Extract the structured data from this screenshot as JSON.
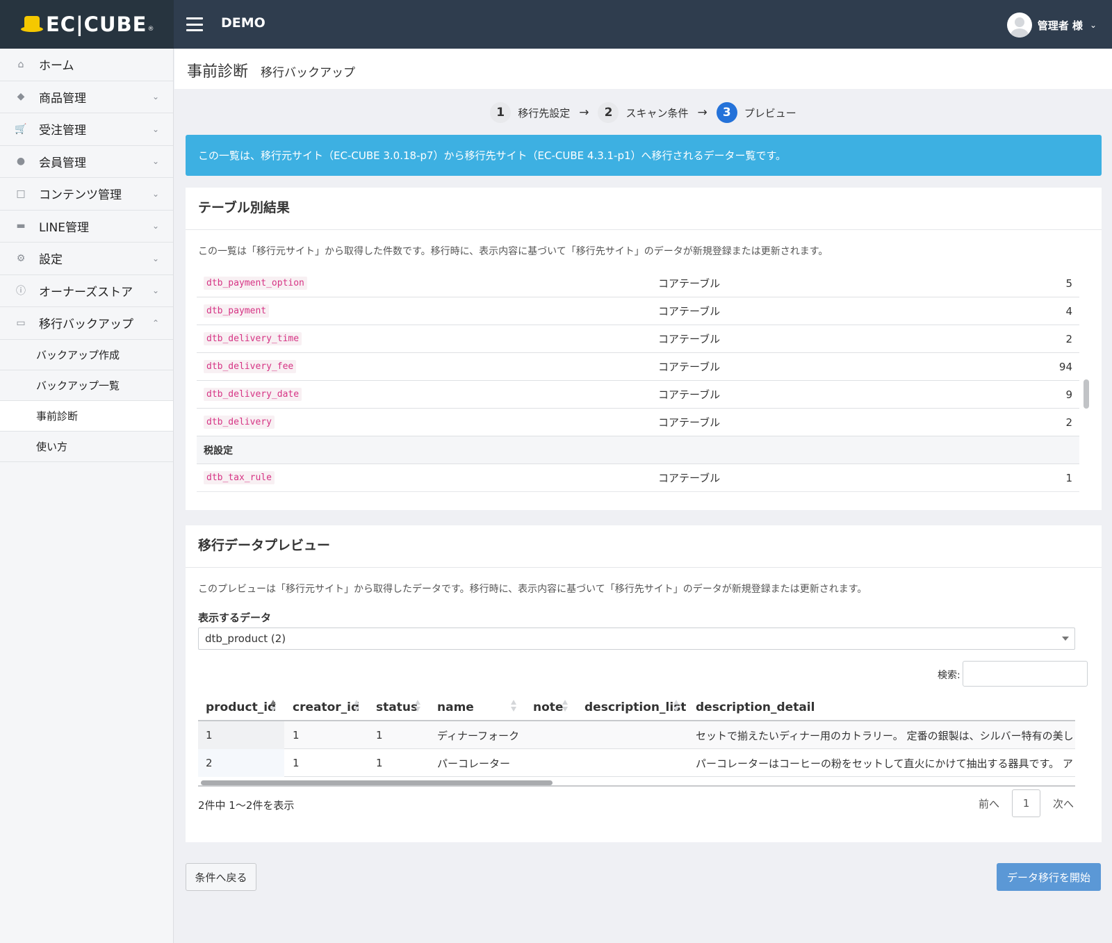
{
  "header": {
    "logo_text": "EC|CUBE",
    "logo_reg": "®",
    "title": "DEMO",
    "user_name": "管理者 様"
  },
  "sidebar": {
    "items": [
      {
        "label": "ホーム",
        "icon": "home-icon"
      },
      {
        "label": "商品管理",
        "icon": "tag-icon"
      },
      {
        "label": "受注管理",
        "icon": "cart-icon"
      },
      {
        "label": "会員管理",
        "icon": "users-icon"
      },
      {
        "label": "コンテンツ管理",
        "icon": "file-icon"
      },
      {
        "label": "LINE管理",
        "icon": "comment-icon"
      },
      {
        "label": "設定",
        "icon": "gear-icon"
      },
      {
        "label": "オーナーズストア",
        "icon": "info-icon"
      },
      {
        "label": "移行バックアップ",
        "icon": "folder-icon"
      }
    ],
    "sub_items": [
      "バックアップ作成",
      "バックアップ一覧",
      "事前診断",
      "使い方"
    ]
  },
  "page": {
    "title": "事前診断",
    "subtitle": "移行バックアップ"
  },
  "steps": [
    {
      "num": "1",
      "label": "移行先設定"
    },
    {
      "num": "2",
      "label": "スキャン条件"
    },
    {
      "num": "3",
      "label": "プレビュー"
    }
  ],
  "steps_arrow": "→",
  "alert": "この一覧は、移行元サイト（EC-CUBE 3.0.18-p7）から移行先サイト（EC-CUBE 4.3.1-p1）へ移行されるデーター覧です。",
  "table_results": {
    "title": "テーブル別結果",
    "description": "この一覧は「移行元サイト」から取得した件数です。移行時に、表示内容に基づいて「移行先サイト」のデータが新規登録または更新されます。",
    "rows": [
      {
        "table": "dtb_payment_option",
        "category": "コアテーブル",
        "count": "5"
      },
      {
        "table": "dtb_payment",
        "category": "コアテーブル",
        "count": "4"
      },
      {
        "table": "dtb_delivery_time",
        "category": "コアテーブル",
        "count": "2"
      },
      {
        "table": "dtb_delivery_fee",
        "category": "コアテーブル",
        "count": "94"
      },
      {
        "table": "dtb_delivery_date",
        "category": "コアテーブル",
        "count": "9"
      },
      {
        "table": "dtb_delivery",
        "category": "コアテーブル",
        "count": "2"
      }
    ],
    "group_label": "税設定",
    "group_rows": [
      {
        "table": "dtb_tax_rule",
        "category": "コアテーブル",
        "count": "1"
      }
    ]
  },
  "preview": {
    "title": "移行データプレビュー",
    "description": "このプレビューは「移行元サイト」から取得したデータです。移行時に、表示内容に基づいて「移行先サイト」のデータが新規登録または更新されます。",
    "select_label": "表示するデータ",
    "select_value": "dtb_product (2)",
    "search_label": "検索:",
    "search_value": "",
    "columns": [
      "product_id",
      "creator_id",
      "status",
      "name",
      "note",
      "description_list",
      "description_detail"
    ],
    "rows": [
      [
        "1",
        "1",
        "1",
        "ディナーフォーク",
        "",
        "",
        "セットで揃えたいディナー用のカトラリー。 定番の銀製は、シルバー特有の美し"
      ],
      [
        "2",
        "1",
        "1",
        "パーコレーター",
        "",
        "",
        "パーコレーターはコーヒーの粉をセットして直火にかけて抽出する器具です。 ア"
      ]
    ],
    "info": "2件中 1〜2件を表示",
    "prev": "前へ",
    "page": "1",
    "next": "次へ"
  },
  "buttons": {
    "back": "条件へ戻る",
    "start": "データ移行を開始"
  },
  "colors": {
    "header": "#2f3d4e",
    "alert": "#3db0e2",
    "active_step": "#2472d9",
    "start_button": "#5b98d6",
    "code": "#d63384"
  }
}
